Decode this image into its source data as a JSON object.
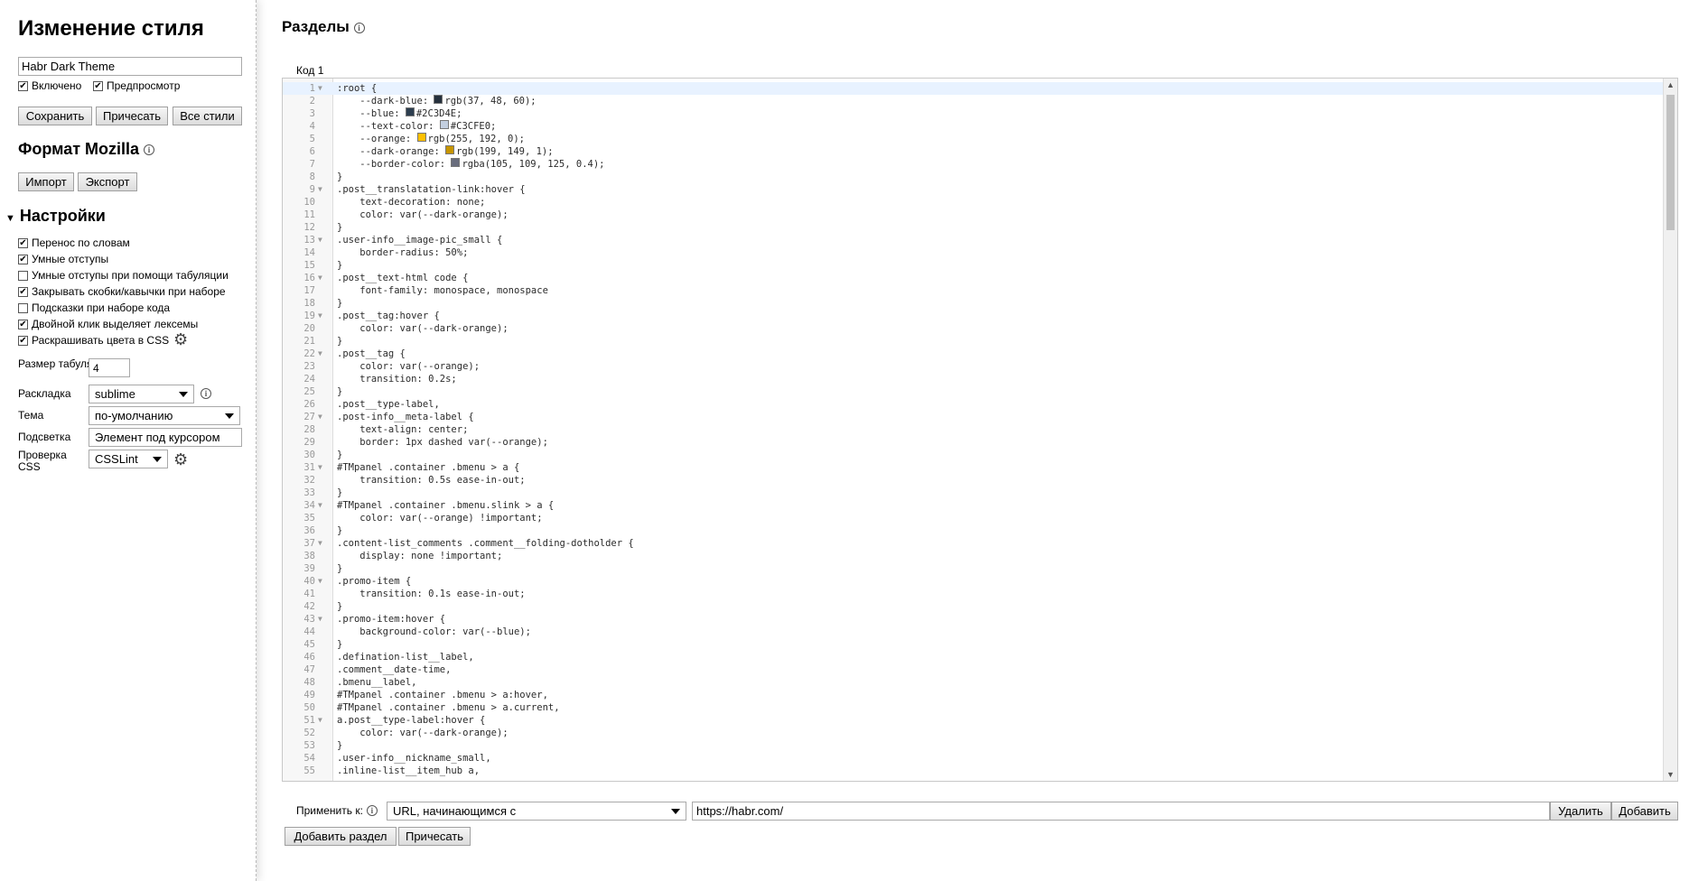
{
  "sidebar": {
    "title": "Изменение стиля",
    "style_name": "Habr Dark Theme",
    "enabled_label": "Включено",
    "preview_label": "Предпросмотр",
    "save_label": "Сохранить",
    "beautify_label": "Причесать",
    "all_styles_label": "Все стили",
    "mozilla_title": "Формат Mozilla",
    "import_label": "Импорт",
    "export_label": "Экспорт",
    "settings_title": "Настройки",
    "options": [
      {
        "label": "Перенос по словам",
        "checked": true
      },
      {
        "label": "Умные отступы",
        "checked": true
      },
      {
        "label": "Умные отступы при помощи табуляции",
        "checked": false
      },
      {
        "label": "Закрывать скобки/кавычки при наборе",
        "checked": true
      },
      {
        "label": "Подсказки при наборе кода",
        "checked": false
      },
      {
        "label": "Двойной клик выделяет лексемы",
        "checked": true
      },
      {
        "label": "Раскрашивать цвета в CSS",
        "checked": true
      }
    ],
    "tab_size_label": "Размер табуляции",
    "tab_size_value": "4",
    "keymap_label": "Раскладка",
    "keymap_value": "sublime",
    "theme_label": "Тема",
    "theme_value": "по-умолчанию",
    "highlight_label": "Подсветка",
    "highlight_value": "Элемент под курсором",
    "lint_label": "Проверка CSS",
    "lint_value": "CSSLint"
  },
  "main": {
    "title": "Разделы",
    "code_tab": "Код 1",
    "code": [
      ":root {",
      "    --dark-blue: ■rgb(37, 48, 60);",
      "    --blue: ■#2C3D4E;",
      "    --text-color: ■#C3CFE0;",
      "    --orange: ■rgb(255, 192, 0);",
      "    --dark-orange: ■rgb(199, 149, 1);",
      "    --border-color: ■rgba(105, 109, 125, 0.4);",
      "}",
      ".post__translatation-link:hover {",
      "    text-decoration: none;",
      "    color: var(--dark-orange);",
      "}",
      ".user-info__image-pic_small {",
      "    border-radius: 50%;",
      "}",
      ".post__text-html code {",
      "    font-family: monospace, monospace",
      "}",
      ".post__tag:hover {",
      "    color: var(--dark-orange);",
      "}",
      ".post__tag {",
      "    color: var(--orange);",
      "    transition: 0.2s;",
      "}",
      ".post__type-label,",
      ".post-info__meta-label {",
      "    text-align: center;",
      "    border: 1px dashed var(--orange);",
      "}",
      "#TMpanel .container .bmenu > a {",
      "    transition: 0.5s ease-in-out;",
      "}",
      "#TMpanel .container .bmenu.slink > a {",
      "    color: var(--orange) !important;",
      "}",
      ".content-list_comments .comment__folding-dotholder {",
      "    display: none !important;",
      "}",
      ".promo-item {",
      "    transition: 0.1s ease-in-out;",
      "}",
      ".promo-item:hover {",
      "    background-color: var(--blue);",
      "}",
      ".defination-list__label,",
      ".comment__date-time,",
      ".bmenu__label,",
      "#TMpanel .container .bmenu > a:hover,",
      "#TMpanel .container .bmenu > a.current,",
      "a.post__type-label:hover {",
      "    color: var(--dark-orange);",
      "}",
      ".user-info__nickname_small,",
      ".inline-list__item_hub a,"
    ],
    "fold_lines": [
      1,
      9,
      13,
      16,
      19,
      22,
      27,
      31,
      34,
      37,
      40,
      43,
      51
    ],
    "apply_label": "Применить к:",
    "apply_type": "URL, начинающимся с",
    "apply_url": "https://habr.com/",
    "delete_label": "Удалить",
    "add_label": "Добавить",
    "add_section_label": "Добавить раздел",
    "beautify_label": "Причесать"
  }
}
